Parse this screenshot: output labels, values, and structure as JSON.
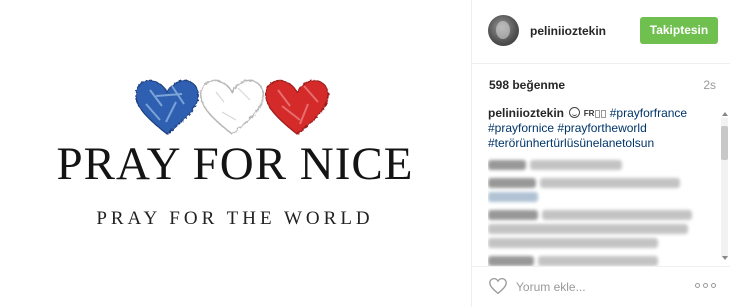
{
  "post_image": {
    "headline": "PRAY FOR NICE",
    "subline": "PRAY FOR THE WORLD",
    "heart_colors": [
      "#2f5fb0",
      "#e8e8e8",
      "#d42a2a"
    ]
  },
  "header": {
    "username": "peliniioztekin",
    "follow_button": "Takiptesin",
    "follow_color": "#70c050"
  },
  "stats": {
    "likes": "598 beğenme",
    "time": "2s"
  },
  "caption": {
    "username": "peliniioztekin",
    "emoji_text": "FR",
    "tags": [
      "#prayforfrance",
      "#prayfornice",
      "#prayfortheworld",
      "#terörünhertürlüsünelanetolsun"
    ]
  },
  "footer": {
    "comment_placeholder": "Yorum ekle..."
  }
}
